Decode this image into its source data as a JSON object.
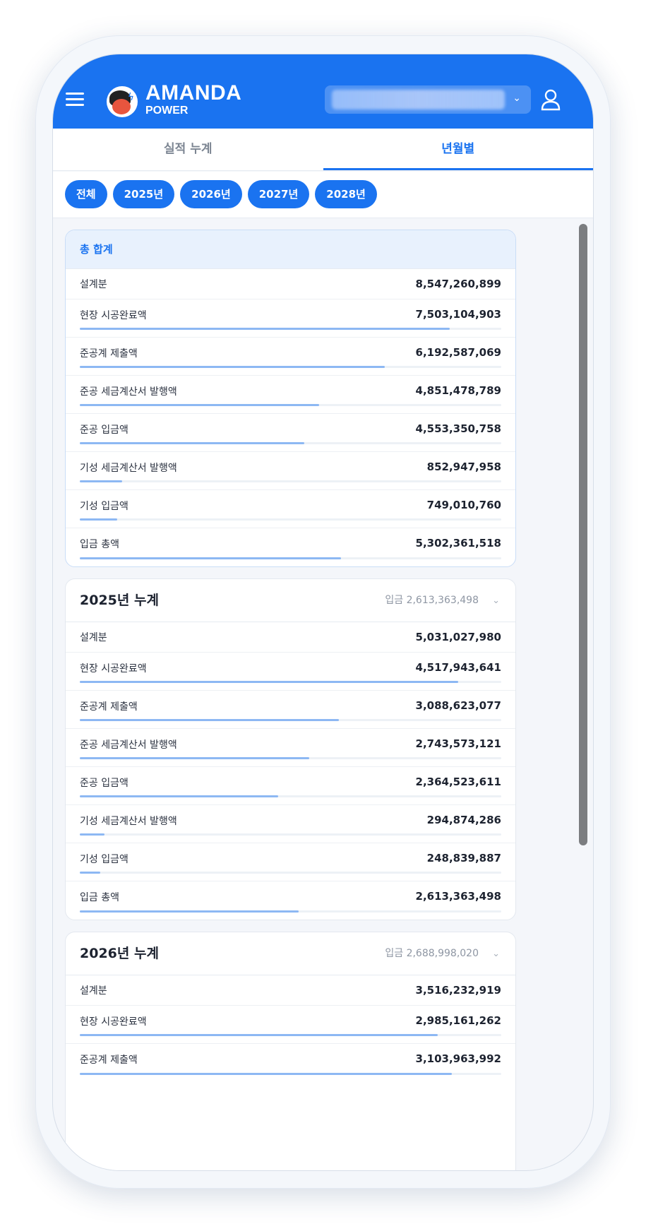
{
  "header": {
    "brand_main": "AMANDA",
    "brand_sub": "POWER",
    "company_select_value": ""
  },
  "tabs": [
    {
      "label": "실적 누계",
      "active": false
    },
    {
      "label": "년월별",
      "active": true
    }
  ],
  "year_filters": [
    "전체",
    "2025년",
    "2026년",
    "2027년",
    "2028년"
  ],
  "total": {
    "title": "총 합계",
    "rows": [
      {
        "label": "설계분",
        "value": "8,547,260,899"
      },
      {
        "label": "현장 시공완료액",
        "value": "7,503,104,903",
        "progress": 0.878
      },
      {
        "label": "준공계 제출액",
        "value": "6,192,587,069",
        "progress": 0.724
      },
      {
        "label": "준공 세금계산서 발행액",
        "value": "4,851,478,789",
        "progress": 0.568
      },
      {
        "label": "준공 입금액",
        "value": "4,553,350,758",
        "progress": 0.533
      },
      {
        "label": "기성 세금계산서 발행액",
        "value": "852,947,958",
        "progress": 0.1
      },
      {
        "label": "기성 입금액",
        "value": "749,010,760",
        "progress": 0.088
      },
      {
        "label": "입금 총액",
        "value": "5,302,361,518",
        "progress": 0.62
      }
    ]
  },
  "years": [
    {
      "title": "2025년 누계",
      "summary": "입금 2,613,363,498",
      "rows": [
        {
          "label": "설계분",
          "value": "5,031,027,980"
        },
        {
          "label": "현장 시공완료액",
          "value": "4,517,943,641",
          "progress": 0.898
        },
        {
          "label": "준공계 제출액",
          "value": "3,088,623,077",
          "progress": 0.614
        },
        {
          "label": "준공 세금계산서 발행액",
          "value": "2,743,573,121",
          "progress": 0.545
        },
        {
          "label": "준공 입금액",
          "value": "2,364,523,611",
          "progress": 0.47
        },
        {
          "label": "기성 세금계산서 발행액",
          "value": "294,874,286",
          "progress": 0.059
        },
        {
          "label": "기성 입금액",
          "value": "248,839,887",
          "progress": 0.049
        },
        {
          "label": "입금 총액",
          "value": "2,613,363,498",
          "progress": 0.519
        }
      ]
    },
    {
      "title": "2026년 누계",
      "summary": "입금 2,688,998,020",
      "rows": [
        {
          "label": "설계분",
          "value": "3,516,232,919"
        },
        {
          "label": "현장 시공완료액",
          "value": "2,985,161,262",
          "progress": 0.849
        },
        {
          "label": "준공계 제출액",
          "value": "3,103,963,992",
          "progress": 0.883
        }
      ]
    }
  ]
}
